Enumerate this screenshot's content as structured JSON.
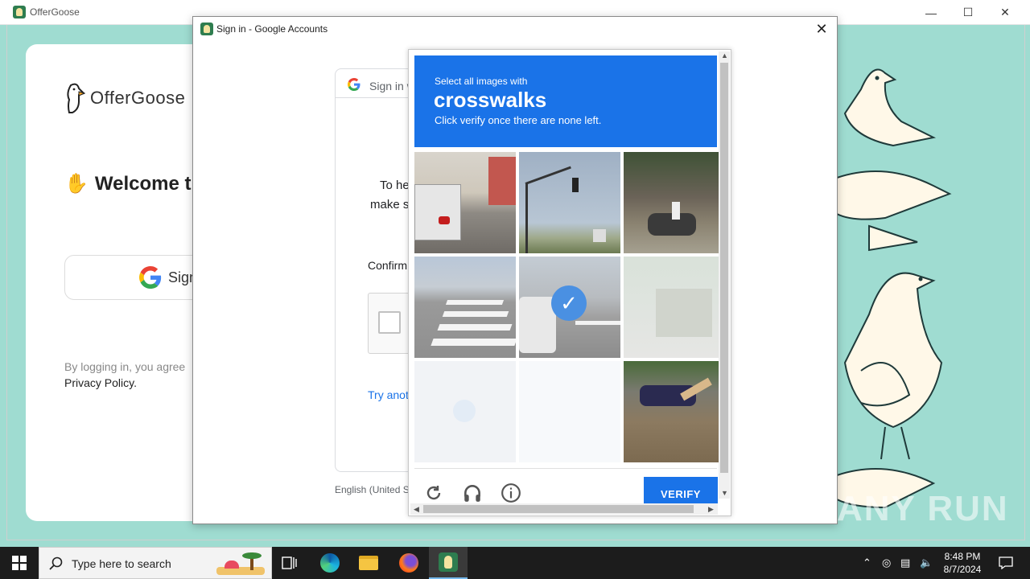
{
  "app": {
    "title": "OfferGoose",
    "logo_text": "OfferGoose",
    "welcome": "Welcome t",
    "google_button": "Sign",
    "legal_line1": "By logging in, you agree",
    "legal_line2": "Privacy Policy."
  },
  "popup": {
    "title": "Sign in - Google Accounts",
    "header": "Sign in w",
    "line1": "To he",
    "line2": "make s",
    "confirm": "Confirm",
    "try_another": "Try anot",
    "language": "English (United S"
  },
  "captcha": {
    "instruction_small": "Select all images with",
    "instruction_big": "crosswalks",
    "instruction_sub": "Click verify once there are none left.",
    "verify_label": "VERIFY",
    "tiles": [
      {
        "selected": false,
        "state": "image",
        "desc": "truck"
      },
      {
        "selected": false,
        "state": "image",
        "desc": "traffic-light"
      },
      {
        "selected": false,
        "state": "image",
        "desc": "motorbikes"
      },
      {
        "selected": false,
        "state": "image",
        "desc": "crosswalk"
      },
      {
        "selected": true,
        "state": "image",
        "desc": "crosswalk-street"
      },
      {
        "selected": false,
        "state": "fading",
        "desc": "tree"
      },
      {
        "selected": false,
        "state": "fading",
        "desc": "faded"
      },
      {
        "selected": false,
        "state": "loading",
        "desc": "blank"
      },
      {
        "selected": false,
        "state": "image",
        "desc": "motorbike-road"
      }
    ]
  },
  "taskbar": {
    "search_placeholder": "Type here to search",
    "time": "8:48 PM",
    "date": "8/7/2024"
  },
  "watermark": "ANY RUN",
  "colors": {
    "accent": "#1a73e8",
    "background": "#9fdcd1"
  }
}
